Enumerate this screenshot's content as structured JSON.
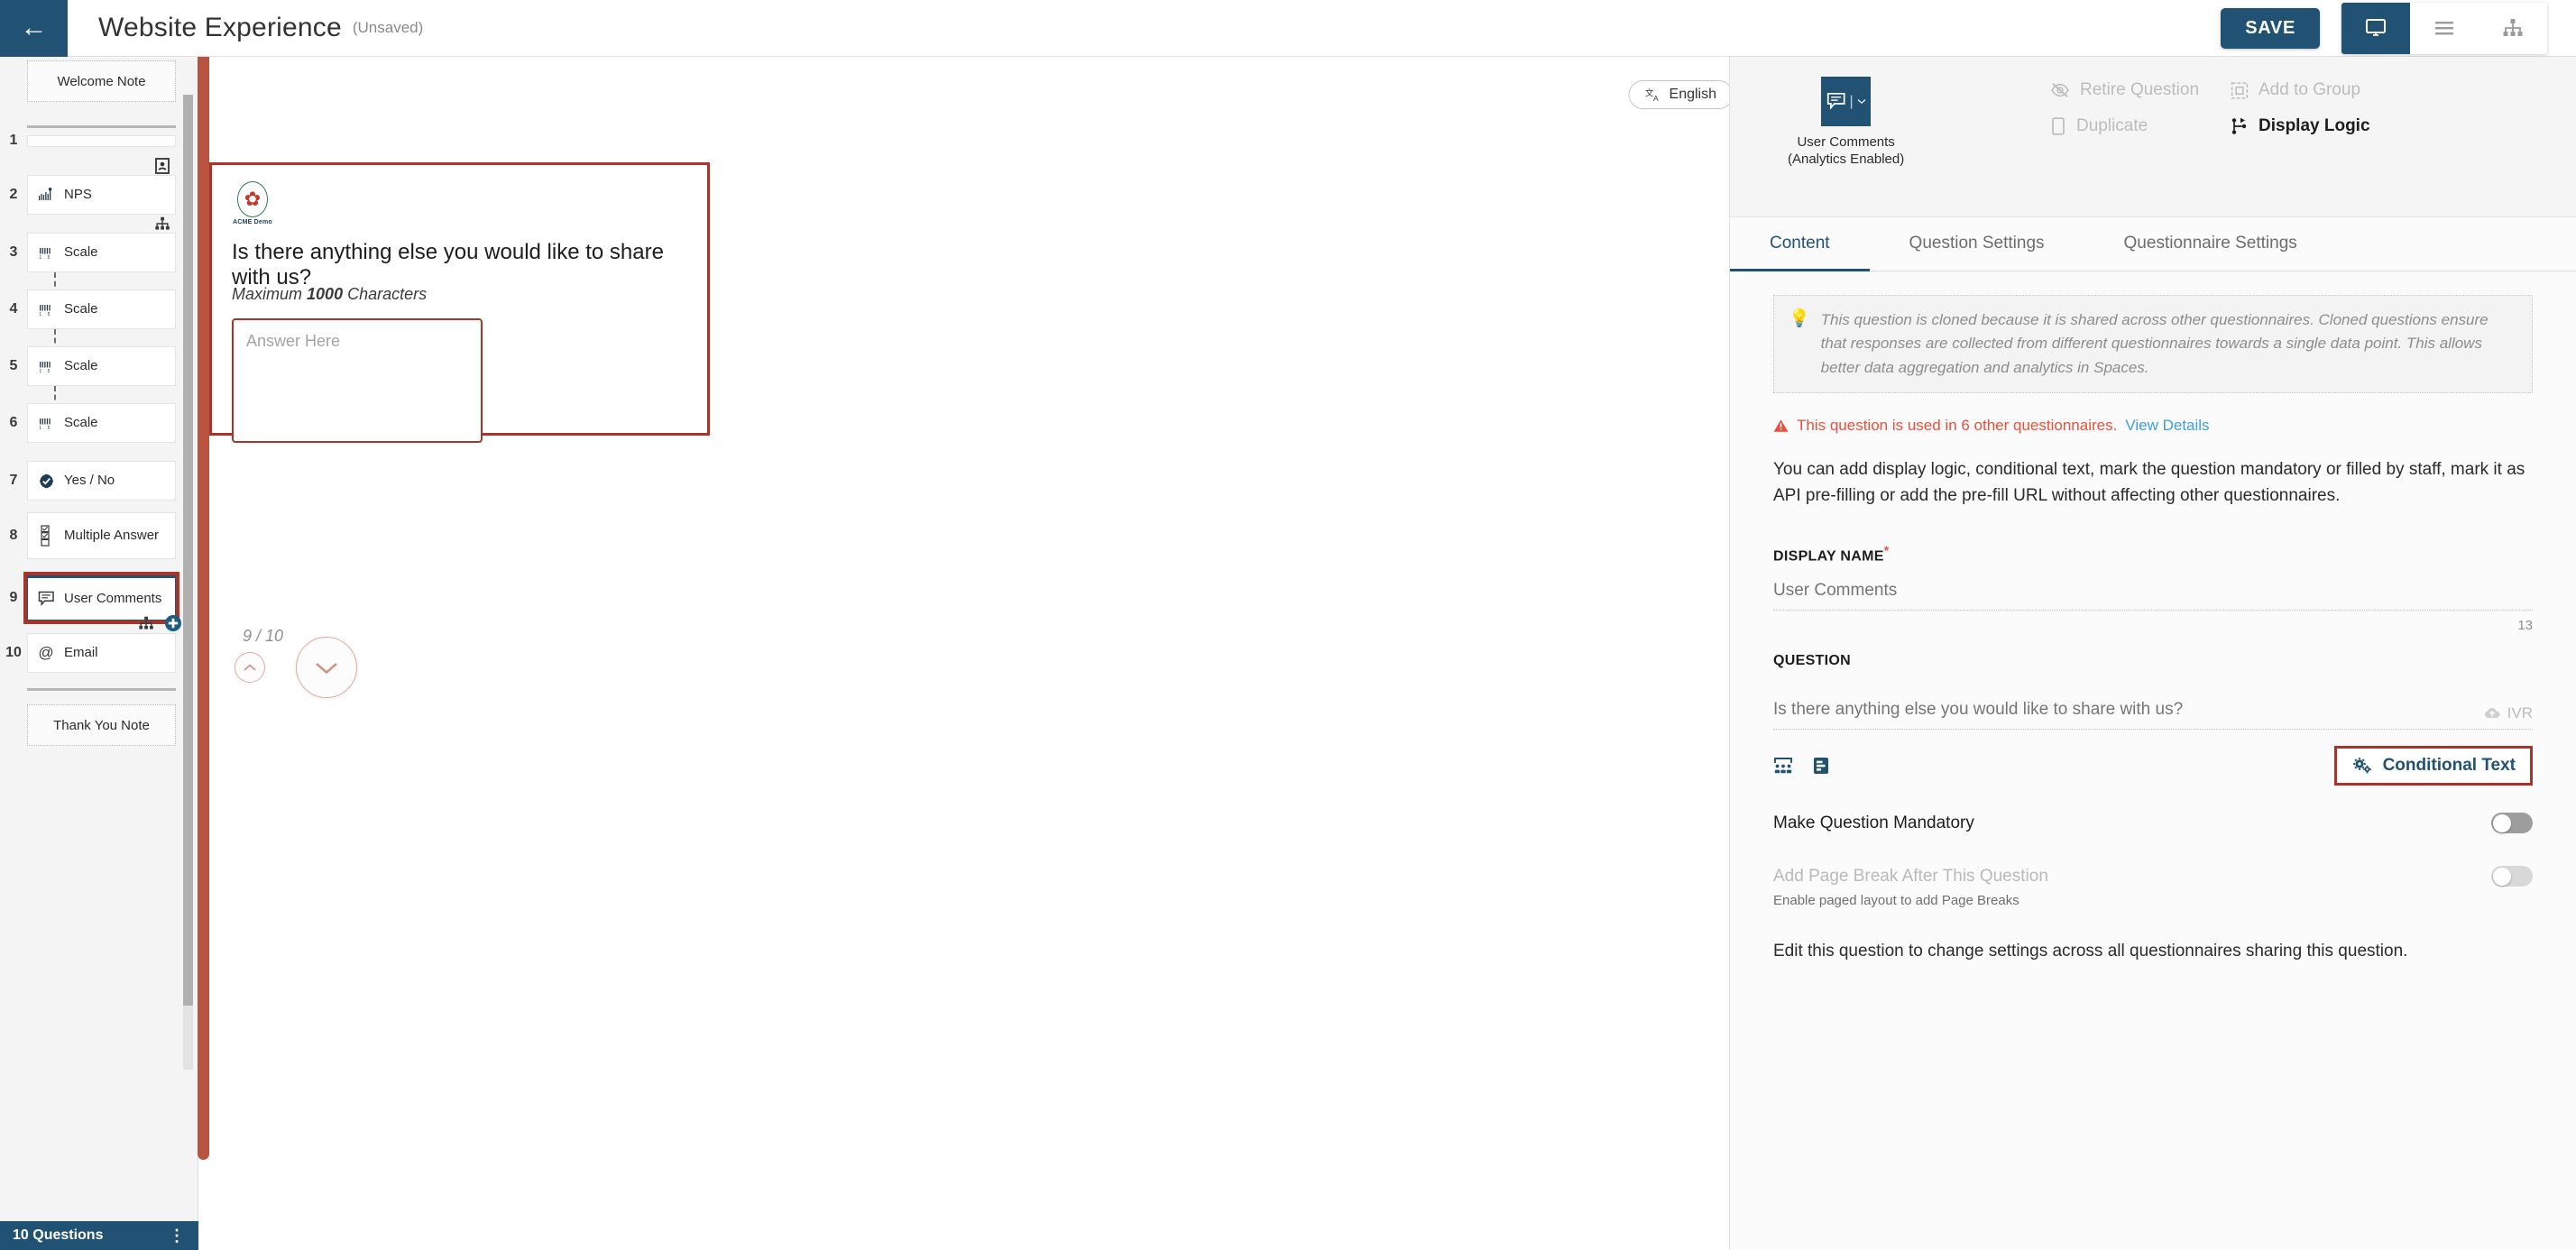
{
  "topbar": {
    "back_icon": "back-arrow-icon",
    "title": "Website Experience",
    "unsaved_label": "(Unsaved)",
    "save_label": "SAVE",
    "view_desktop_icon": "monitor-icon",
    "view_list_icon": "list-icon",
    "view_tree_icon": "sitemap-icon"
  },
  "sidebar": {
    "welcome_note": "Welcome Note",
    "thank_you_note": "Thank You Note",
    "footer_count": "10 Questions",
    "footer_menu": "⋮",
    "items": [
      {
        "num": "1",
        "label": "",
        "icon": "contact-card-icon",
        "type": "blank"
      },
      {
        "num": "2",
        "label": "NPS",
        "icon": "nps-chart-icon"
      },
      {
        "num": "3",
        "label": "Scale",
        "icon": "scale-icon"
      },
      {
        "num": "4",
        "label": "Scale",
        "icon": "scale-icon"
      },
      {
        "num": "5",
        "label": "Scale",
        "icon": "scale-icon"
      },
      {
        "num": "6",
        "label": "Scale",
        "icon": "scale-icon"
      },
      {
        "num": "7",
        "label": "Yes / No",
        "icon": "yes-no-icon"
      },
      {
        "num": "8",
        "label": "Multiple Answer",
        "icon": "checkbox-list-icon"
      },
      {
        "num": "9",
        "label": "User Comments",
        "icon": "comment-icon",
        "selected": true
      },
      {
        "num": "10",
        "label": "Email",
        "icon": "at-sign-icon"
      }
    ]
  },
  "canvas": {
    "language_label": "English",
    "language_icon": "translate-icon",
    "brand_name": "ACME Demo",
    "question_title": "Is there anything else you would like to share with us?",
    "max_prefix": "Maximum",
    "max_value": "1000",
    "max_suffix": "Characters",
    "answer_placeholder": "Answer Here",
    "pager": "9 / 10",
    "nav_up_icon": "chevron-up-icon",
    "nav_down_icon": "chevron-down-icon"
  },
  "right_panel": {
    "question_type": "User Comments",
    "question_type_sub": "(Analytics Enabled)",
    "type_icon": "comment-icon",
    "type_caret": "chevron-down-icon",
    "actions": [
      {
        "label": "Retire Question",
        "icon": "eye-slash-icon",
        "enabled": false
      },
      {
        "label": "Add to Group",
        "icon": "group-icon",
        "enabled": false
      },
      {
        "label": "Duplicate",
        "icon": "copy-icon",
        "enabled": false
      },
      {
        "label": "Display Logic",
        "icon": "branch-icon",
        "enabled": true
      }
    ],
    "tabs": [
      {
        "label": "Content",
        "active": true
      },
      {
        "label": "Question Settings",
        "active": false
      },
      {
        "label": "Questionnaire Settings",
        "active": false
      }
    ],
    "tip_icon": "lightbulb-icon",
    "tip_text": "This question is cloned because it is shared across other questionnaires. Cloned questions ensure that responses are collected from different questionnaires towards a single data point. This allows better data aggregation and analytics in Spaces.",
    "warn_icon": "warning-icon",
    "warn_text": "This question is used in 6 other questionnaires.",
    "warn_link": "View Details",
    "description": "You can add display logic, conditional text, mark the question mandatory or filled by staff, mark it as API pre-filling or add the pre-fill URL without affecting other questionnaires.",
    "display_name_label": "DISPLAY NAME",
    "display_name_required": "*",
    "display_name_value": "User Comments",
    "display_name_count": "13",
    "question_label": "QUESTION",
    "question_value": "Is there anything else you would like to share with us?",
    "ivr_label": "IVR",
    "ivr_icon": "cloud-upload-icon",
    "tool_icons": [
      {
        "name": "audience-icon"
      },
      {
        "name": "format-icon"
      }
    ],
    "conditional_text_label": "Conditional Text",
    "conditional_text_icon": "gears-icon",
    "mandatory_label": "Make Question Mandatory",
    "mandatory_on": false,
    "page_break_label": "Add Page Break After This Question",
    "page_break_hint": "Enable paged layout to add Page Breaks",
    "page_break_on": false,
    "edit_note": "Edit this question to change settings across all questionnaires sharing this question."
  },
  "colors": {
    "brand_navy": "#215273",
    "accent_rust": "#a9352a",
    "rust_bar": "#b9533f",
    "link_blue": "#3c9fd9",
    "warning_red": "#e8503a"
  }
}
